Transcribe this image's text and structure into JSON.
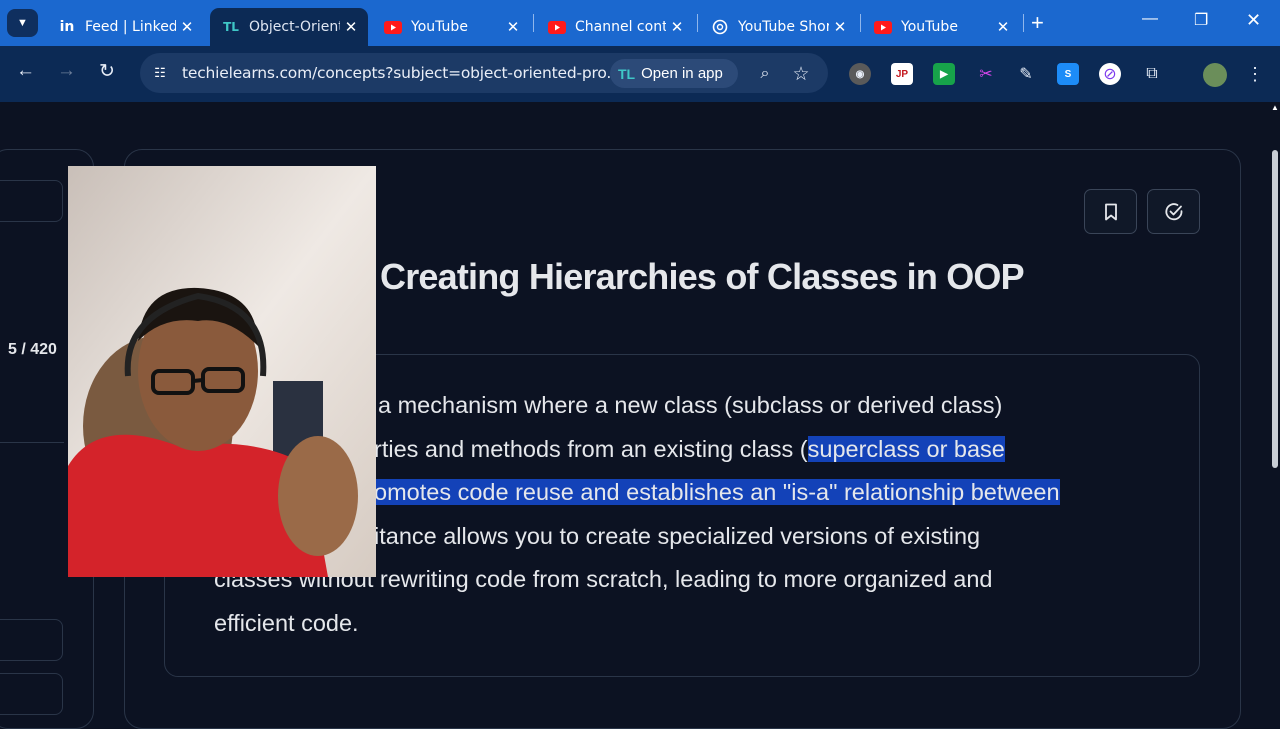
{
  "browser": {
    "tabs": [
      {
        "label": "Feed | LinkedIn",
        "icon": "linkedin-icon"
      },
      {
        "label": "Object-Oriented Programming",
        "icon": "techielearns-icon"
      },
      {
        "label": "YouTube",
        "icon": "youtube-icon"
      },
      {
        "label": "Channel content",
        "icon": "youtube-icon"
      },
      {
        "label": "YouTube Shorts",
        "icon": "chatgpt-icon"
      },
      {
        "label": "YouTube",
        "icon": "youtube-icon"
      }
    ],
    "url": "techielearns.com/concepts?subject=object-oriented-pro...",
    "open_in_app": "Open in app",
    "open_in_app_logo": "TL"
  },
  "page": {
    "counter": "5 / 420",
    "title": "Creating Hierarchies of Classes in OOP",
    "paragraph": [
      [
        {
          "t": "a mechanism where a new class (subclass or derived class)",
          "h": false
        }
      ],
      [
        {
          "t": "rties and methods from an existing class (",
          "h": false
        },
        {
          "t": "superclass or base",
          "h": true
        }
      ],
      [
        {
          "t": "omotes code reuse and establishes an \"is-a\" relationship between",
          "h": true
        }
      ],
      [
        {
          "t": "itance allows you to create specialized versions of existing",
          "h": false
        }
      ],
      [
        {
          "t": "classes without rewriting code from scratch, leading to more organized and",
          "h": false
        }
      ],
      [
        {
          "t": "efficient code.",
          "h": false
        }
      ]
    ]
  },
  "colors": {
    "tab_bar": "#1b68cf",
    "toolbar": "#0c2a55",
    "page_bg": "#0c1222",
    "highlight": "#1342b8"
  }
}
